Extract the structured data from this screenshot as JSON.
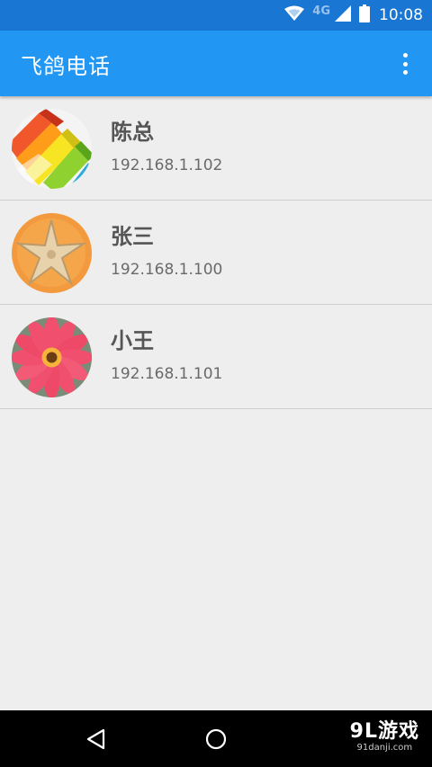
{
  "status_bar": {
    "network_label": "4G",
    "time": "10:08",
    "icons": [
      "wifi-icon",
      "signal-icon",
      "battery-icon"
    ]
  },
  "app_bar": {
    "title": "飞鸽电话",
    "overflow_icon": "more-vert-icon"
  },
  "contacts": [
    {
      "name": "陈总",
      "ip": "192.168.1.102",
      "avatar": "highlighter-markers"
    },
    {
      "name": "张三",
      "ip": "192.168.1.100",
      "avatar": "starfish"
    },
    {
      "name": "小王",
      "ip": "192.168.1.101",
      "avatar": "pink-flower"
    }
  ],
  "nav_bar": {
    "buttons": [
      "back-icon",
      "home-icon"
    ]
  },
  "watermark": {
    "main": "9L游戏",
    "sub": "91danji.com"
  },
  "colors": {
    "status_bar": "#1976d2",
    "app_bar": "#2196f3",
    "background": "#eeeeee",
    "divider": "#cfcfcf",
    "name_text": "#555555",
    "ip_text": "#6a6a6a"
  }
}
